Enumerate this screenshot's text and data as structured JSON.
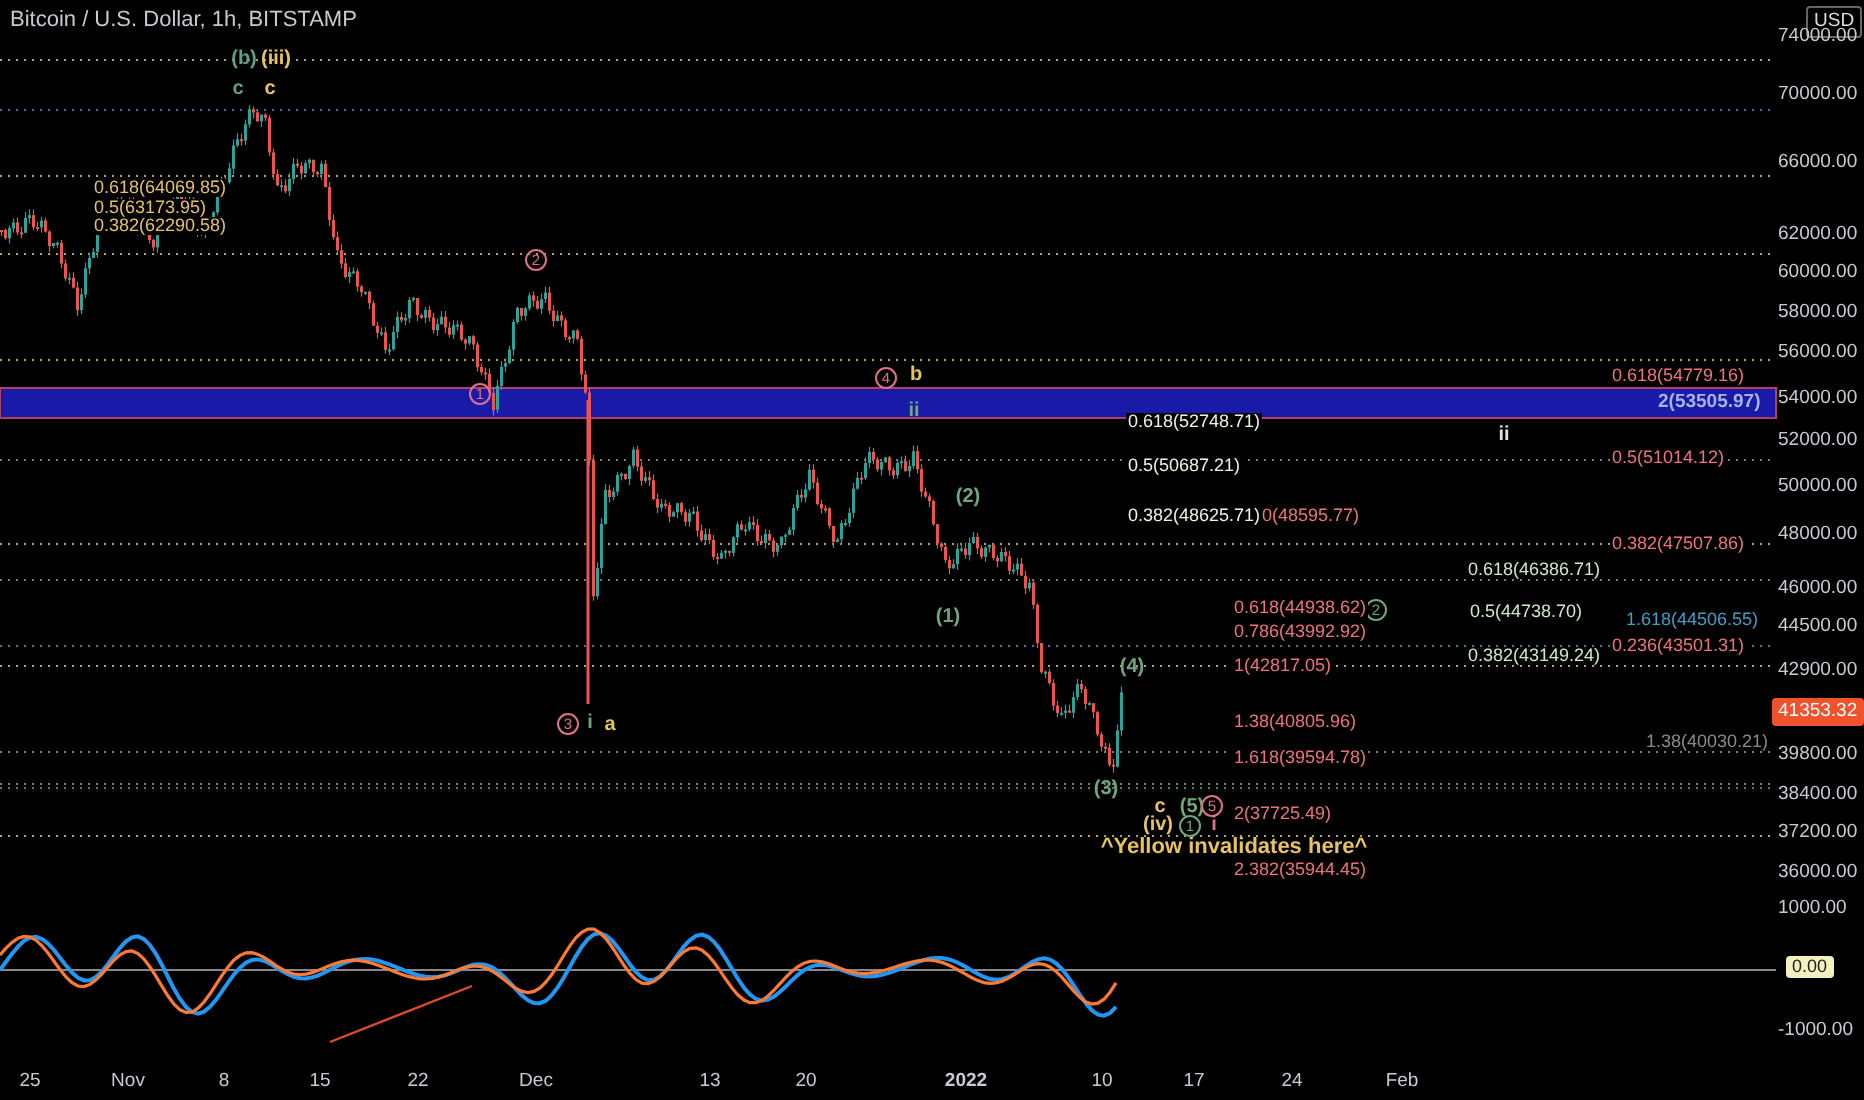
{
  "header": {
    "title": "Bitcoin / U.S. Dollar, 1h, BITSTAMP",
    "currency": "USD"
  },
  "price_axis": [
    "74000.00",
    "70000.00",
    "66000.00",
    "62000.00",
    "60000.00",
    "58000.00",
    "56000.00",
    "54000.00",
    "52000.00",
    "50000.00",
    "48000.00",
    "46000.00",
    "44500.00",
    "42900.00",
    "39800.00",
    "38400.00",
    "37200.00",
    "36000.00"
  ],
  "last_price": "41353.32",
  "indicator_axis": [
    "1000.00",
    "-1000.00"
  ],
  "indicator_zero": "0.00",
  "time_axis": [
    "25",
    "Nov",
    "8",
    "15",
    "22",
    "Dec",
    "13",
    "20",
    "2022",
    "10",
    "17",
    "24",
    "Feb"
  ],
  "wave_labels": [
    {
      "text": "(b)",
      "kind": "plain",
      "color": "#5fa08a"
    },
    {
      "text": "(iii)",
      "kind": "plain",
      "color": "#e8c25a"
    },
    {
      "text": "c",
      "kind": "plain",
      "color": "#5fa08a"
    },
    {
      "text": "c",
      "kind": "plain",
      "color": "#e8c25a"
    },
    {
      "text": "2",
      "kind": "circled",
      "color": "#e0708a"
    },
    {
      "text": "1",
      "kind": "circled",
      "color": "#e0708a"
    },
    {
      "text": "4",
      "kind": "circled",
      "color": "#e0708a"
    },
    {
      "text": "b",
      "kind": "plain",
      "color": "#e8c25a"
    },
    {
      "text": "ii",
      "kind": "plain",
      "color": "#6fa77d"
    },
    {
      "text": "(2)",
      "kind": "plain",
      "color": "#6fa77d"
    },
    {
      "text": "(1)",
      "kind": "plain",
      "color": "#6fa77d"
    },
    {
      "text": "(4)",
      "kind": "plain",
      "color": "#6fa77d"
    },
    {
      "text": "3",
      "kind": "circled",
      "color": "#e0708a"
    },
    {
      "text": "i",
      "kind": "plain",
      "color": "#6fa77d"
    },
    {
      "text": "a",
      "kind": "plain",
      "color": "#e8c25a"
    },
    {
      "text": "(3)",
      "kind": "plain",
      "color": "#6fa77d"
    },
    {
      "text": "c",
      "kind": "plain",
      "color": "#e8c25a"
    },
    {
      "text": "(5)",
      "kind": "plain",
      "color": "#6fa77d"
    },
    {
      "text": "5",
      "kind": "circled",
      "color": "#e0708a"
    },
    {
      "text": "(iv)",
      "kind": "plain",
      "color": "#e8c25a"
    },
    {
      "text": "1",
      "kind": "circled",
      "color": "#6fa77d"
    },
    {
      "text": "i",
      "kind": "plain",
      "color": "#e0708a"
    },
    {
      "text": "ii",
      "kind": "plain",
      "color": "#e0e0e0"
    },
    {
      "text": "2",
      "kind": "circled",
      "color": "#6fa77d"
    }
  ],
  "fib_labels": [
    {
      "text": "0.618(64069.85)",
      "color": "#e8c25a"
    },
    {
      "text": "0.5(63173.95)",
      "color": "#e8c25a"
    },
    {
      "text": "0.382(62290.58)",
      "color": "#e8c25a"
    },
    {
      "text": "0.618(52748.71)",
      "color": "#f2f2e0"
    },
    {
      "text": "0.5(50687.21)",
      "color": "#f2f2e0"
    },
    {
      "text": "0.382(48625.71)",
      "color": "#f2f2e0"
    },
    {
      "text": "0(48595.77)",
      "color": "#f0717d"
    },
    {
      "text": "0.618(54779.16)",
      "color": "#f0717d"
    },
    {
      "text": "2(53505.97)",
      "color": "#aab0e8"
    },
    {
      "text": "0.5(51014.12)",
      "color": "#f0717d"
    },
    {
      "text": "0.382(47507.86)",
      "color": "#f0717d"
    },
    {
      "text": "0.236(43501.31)",
      "color": "#f0717d"
    },
    {
      "text": "0.618(44938.62)",
      "color": "#f0717d"
    },
    {
      "text": "0.786(43992.92)",
      "color": "#f0717d"
    },
    {
      "text": "1(42817.05)",
      "color": "#f0717d"
    },
    {
      "text": "1.38(40805.96)",
      "color": "#f0717d"
    },
    {
      "text": "1.618(39594.78)",
      "color": "#f0717d"
    },
    {
      "text": "2(37725.49)",
      "color": "#f0717d"
    },
    {
      "text": "2.382(35944.45)",
      "color": "#f0717d"
    },
    {
      "text": "0.618(46386.71)",
      "color": "#cfe8c6"
    },
    {
      "text": "0.5(44738.70)",
      "color": "#cfe8c6"
    },
    {
      "text": "0.382(43149.24)",
      "color": "#cfe8c6"
    },
    {
      "text": "1.618(44506.55)",
      "color": "#3ba0c8"
    },
    {
      "text": "1.38(40030.21)",
      "color": "#8a8a8a"
    }
  ],
  "note": "^Yellow invalidates here^"
}
